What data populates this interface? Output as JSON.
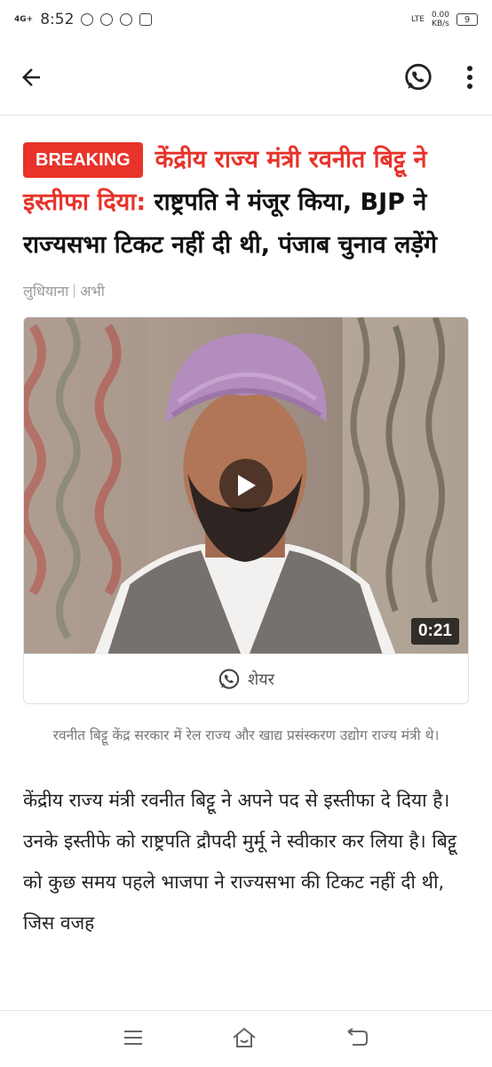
{
  "status_bar": {
    "network": "4G+",
    "time": "8:52",
    "lte": "LTE",
    "speed": "0.00",
    "speed_unit": "KB/s",
    "battery": "9"
  },
  "article": {
    "badge": "BREAKING",
    "headline_red": "केंद्रीय राज्य मंत्री रवनीत बिट्टू ने इस्तीफा दिया:",
    "headline_rest": " राष्ट्रपति ने मंजूर किया, BJP ने राज्यसभा टिकट नहीं दी थी, पंजाब चुनाव लड़ेंगे",
    "location": "लुधियाना",
    "time": "अभी",
    "video_duration": "0:21",
    "share_label": "शेयर",
    "caption": "रवनीत बिट्टू केंद्र सरकार में रेल राज्य और खाद्य प्रसंस्करण उद्योग राज्य मंत्री थे।",
    "body": "केंद्रीय राज्य मंत्री रवनीत बिट्टू ने अपने पद से इस्तीफा दे दिया है। उनके इस्तीफे को राष्ट्रपति द्रौपदी मुर्मू ने स्वीकार कर लिया है। बिट्टू को कुछ समय पहले भाजपा ने राज्यसभा की टिकट नहीं दी थी, जिस वजह"
  },
  "icons": {
    "back": "arrow-left-icon",
    "whatsapp": "whatsapp-icon",
    "menu": "more-vertical-icon",
    "play": "play-icon"
  },
  "colors": {
    "accent": "#e8332a",
    "whatsapp": "#222222"
  }
}
